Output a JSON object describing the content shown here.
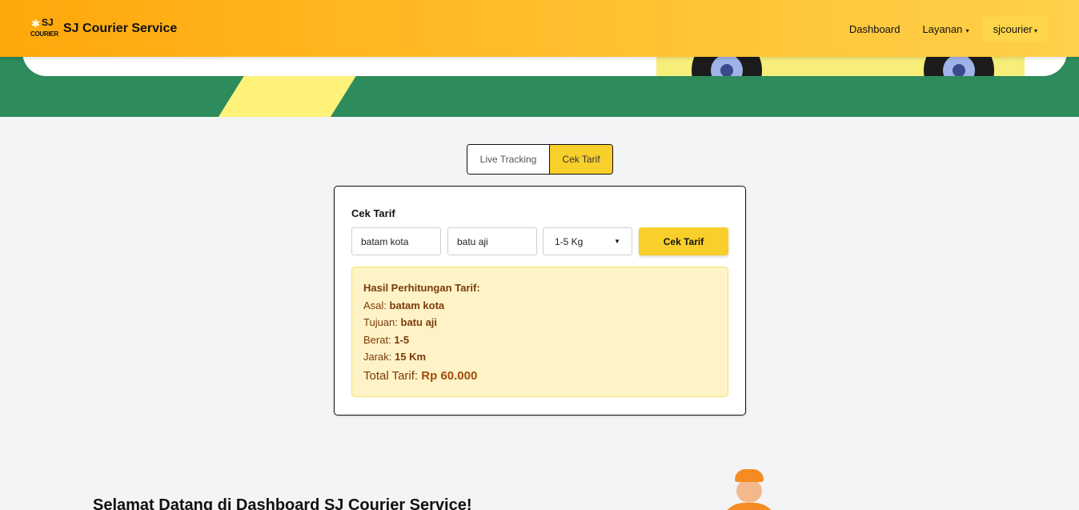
{
  "navbar": {
    "logo_top": "SJ",
    "logo_bottom": "COURIER",
    "brand": "SJ Courier Service",
    "links": {
      "dashboard": "Dashboard",
      "layanan": "Layanan"
    },
    "user": "sjcourier"
  },
  "tabs": {
    "live": "Live Tracking",
    "cek": "Cek Tarif",
    "active": "Cek Tarif"
  },
  "form": {
    "title": "Cek Tarif",
    "origin_value": "batam kota",
    "destination_value": "batu aji",
    "weight_selected": "1-5 Kg",
    "submit_label": "Cek Tarif"
  },
  "result": {
    "title": "Hasil Perhitungan Tarif:",
    "asal_label": "Asal:",
    "asal_value": "batam kota",
    "tujuan_label": "Tujuan:",
    "tujuan_value": "batu aji",
    "berat_label": "Berat:",
    "berat_value": "1-5",
    "jarak_label": "Jarak:",
    "jarak_value": "15 Km",
    "total_label": "Total Tarif:",
    "total_value": "Rp 60.000"
  },
  "welcome": {
    "heading": "Selamat Datang di Dashboard SJ Courier Service!"
  },
  "colors": {
    "navbar_start": "#ffa80a",
    "navbar_end": "#ffd04a",
    "hero_green": "#2e8b5b",
    "accent_yellow": "#f8cf2b",
    "result_bg": "#fef3c7",
    "result_text": "#7a3a0a"
  },
  "icons": [
    "logo-star-icon",
    "chevron-down-icon",
    "dropdown-caret-icon"
  ]
}
